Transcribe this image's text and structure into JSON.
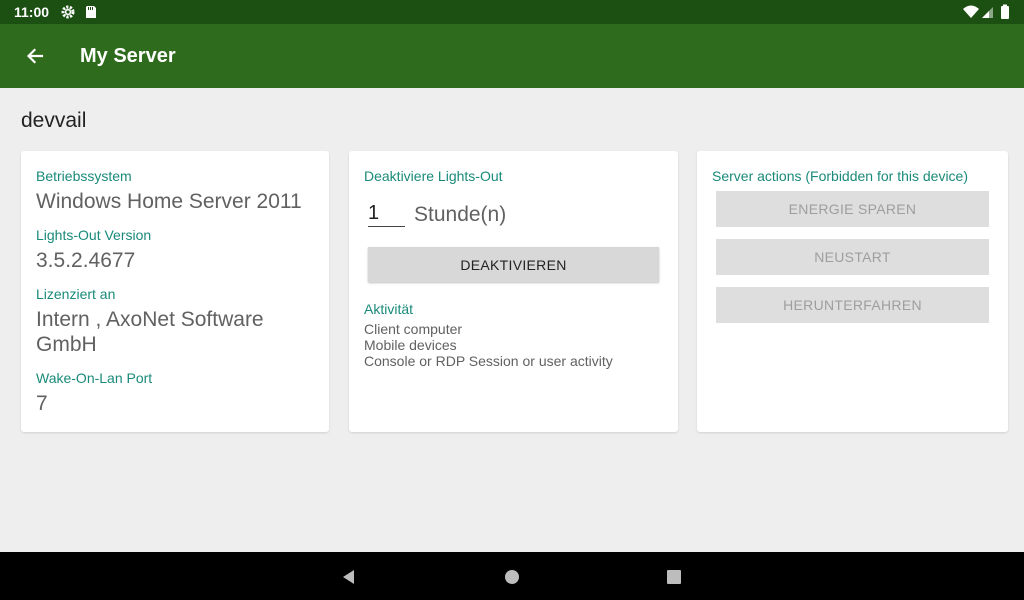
{
  "status_bar": {
    "time": "11:00",
    "left_icons": [
      "settings-icon",
      "sd-card-icon"
    ],
    "right_icons": [
      "wifi-icon",
      "signal-icon",
      "battery-icon"
    ]
  },
  "app_bar": {
    "title": "My Server",
    "color": "#2e6b1c"
  },
  "server": {
    "name": "devvail"
  },
  "info_card": {
    "os_label": "Betriebssystem",
    "os_value": "Windows Home Server 2011",
    "version_label": "Lights-Out Version",
    "version_value": "3.5.2.4677",
    "license_label": "Lizenziert an",
    "license_value": "Intern , AxoNet Software GmbH",
    "wol_label": "Wake-On-Lan Port",
    "wol_value": "7"
  },
  "deactivate_card": {
    "title": "Deaktiviere Lights-Out",
    "hours_value": "1",
    "hours_unit": "Stunde(n)",
    "button_label": "DEAKTIVIEREN",
    "activity_label": "Aktivität",
    "activity_items": [
      "Client computer",
      "Mobile devices",
      "Console or RDP Session or user activity"
    ]
  },
  "actions_card": {
    "title": "Server actions (Forbidden for this device)",
    "buttons": [
      "ENERGIE SPAREN",
      "NEUSTART",
      "HERUNTERFAHREN"
    ]
  },
  "colors": {
    "accent": "#1a8a7a",
    "status_bar": "#1b5012",
    "background": "#eeeeee"
  }
}
